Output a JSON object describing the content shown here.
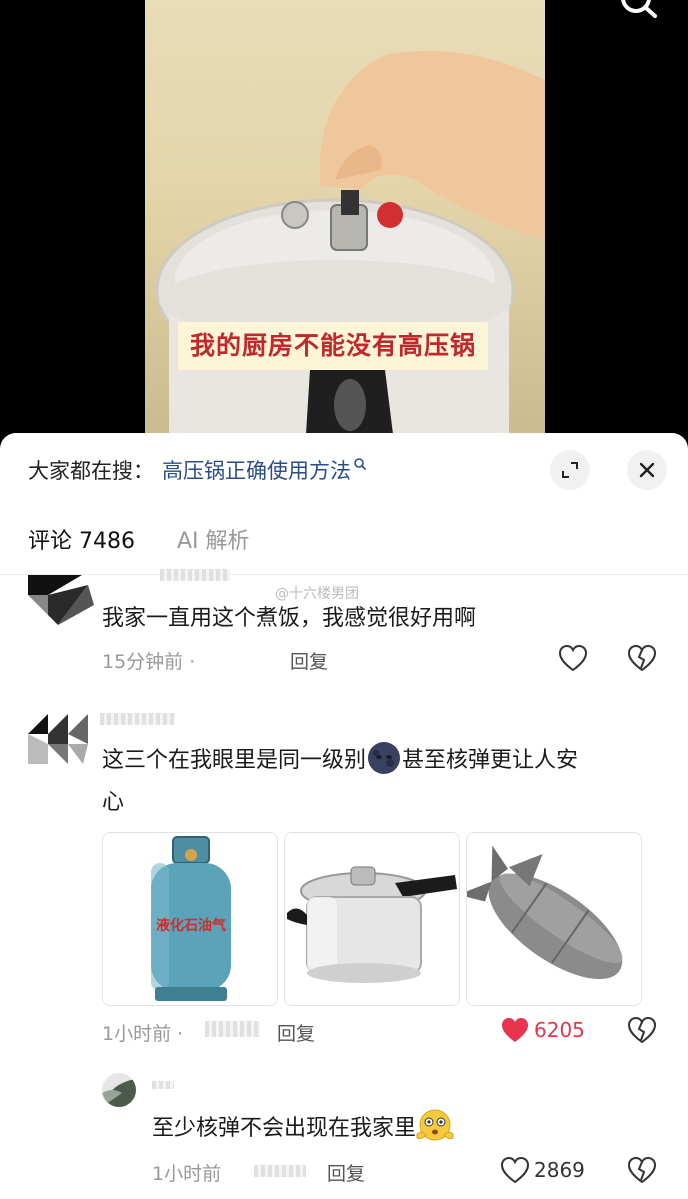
{
  "video": {
    "caption": "我的厨房不能没有高压锅"
  },
  "search": {
    "prefix": "大家都在搜：",
    "term": "高压锅正确使用方法"
  },
  "tabs": {
    "comments_label": "评论 7486",
    "ai_label": "AI 解析"
  },
  "watermark": "@十六楼男团",
  "comments": [
    {
      "text": "我家一直用这个煮饭，我感觉很好用啊",
      "time": "15分钟前 ·",
      "reply": "回复"
    },
    {
      "text_line1": "这三个在我眼里是同一级别",
      "text_line1_tail": "甚至核弹更让人安",
      "text_line2": "心",
      "time": "1小时前 ·",
      "reply": "回复",
      "likes": "6205",
      "images": [
        "液化石油气罐",
        "高压锅",
        "核弹"
      ],
      "cylinder_label": "液化石油气"
    },
    {
      "text": "至少核弹不会出现在我家里",
      "time": "1小时前",
      "reply": "回复",
      "likes": "2869"
    }
  ],
  "colors": {
    "caption_red": "#c0282b",
    "search_link": "#2a4c8a",
    "like_red": "#e8344e"
  }
}
